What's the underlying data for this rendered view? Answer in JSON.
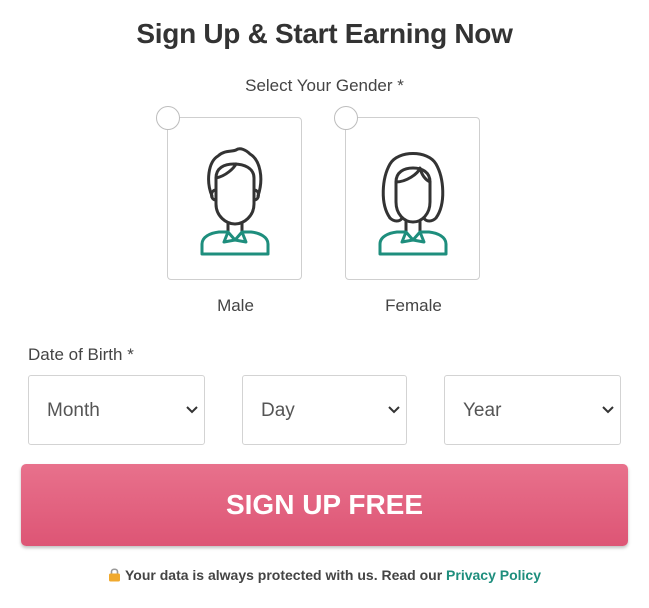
{
  "header": {
    "title": "Sign Up & Start Earning Now"
  },
  "gender": {
    "label": "Select Your Gender *",
    "options": [
      {
        "label": "Male",
        "icon": "male-avatar-icon"
      },
      {
        "label": "Female",
        "icon": "female-avatar-icon"
      }
    ]
  },
  "dob": {
    "label": "Date of Birth *",
    "month": "Month",
    "day": "Day",
    "year": "Year"
  },
  "cta": {
    "label": "SIGN UP FREE"
  },
  "privacy": {
    "text": "Your data is always protected with us. Read our",
    "link": "Privacy Policy"
  },
  "colors": {
    "accent_teal": "#1e8e7d",
    "button_pink": "#e0607d",
    "outline": "#333333"
  }
}
